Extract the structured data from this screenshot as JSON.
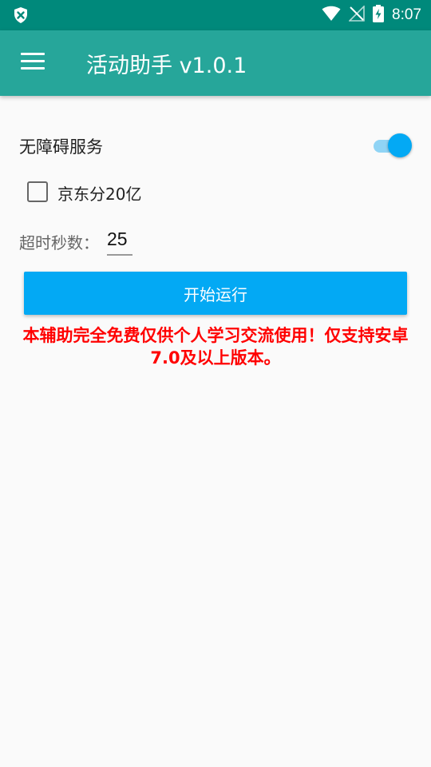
{
  "status_bar": {
    "time": "8:07",
    "icons": [
      "shield-x-icon",
      "wifi-icon",
      "no-signal-icon",
      "battery-charging-icon"
    ]
  },
  "app_bar": {
    "title": "活动助手 v1.0.1",
    "menu_icon": "hamburger-menu-icon"
  },
  "settings": {
    "accessibility_label": "无障碍服务",
    "accessibility_enabled": true,
    "jd_checkbox_label": "京东分20亿",
    "jd_checked": false,
    "timeout_label": "超时秒数：",
    "timeout_value": "25"
  },
  "actions": {
    "start_label": "开始运行"
  },
  "notice": {
    "text": "本辅助完全免费仅供个人学习交流使用！仅支持安卓7.0及以上版本。"
  },
  "colors": {
    "status_bar": "#00897b",
    "app_bar": "#26a69a",
    "accent": "#03a9f4",
    "notice": "#ff0000"
  }
}
